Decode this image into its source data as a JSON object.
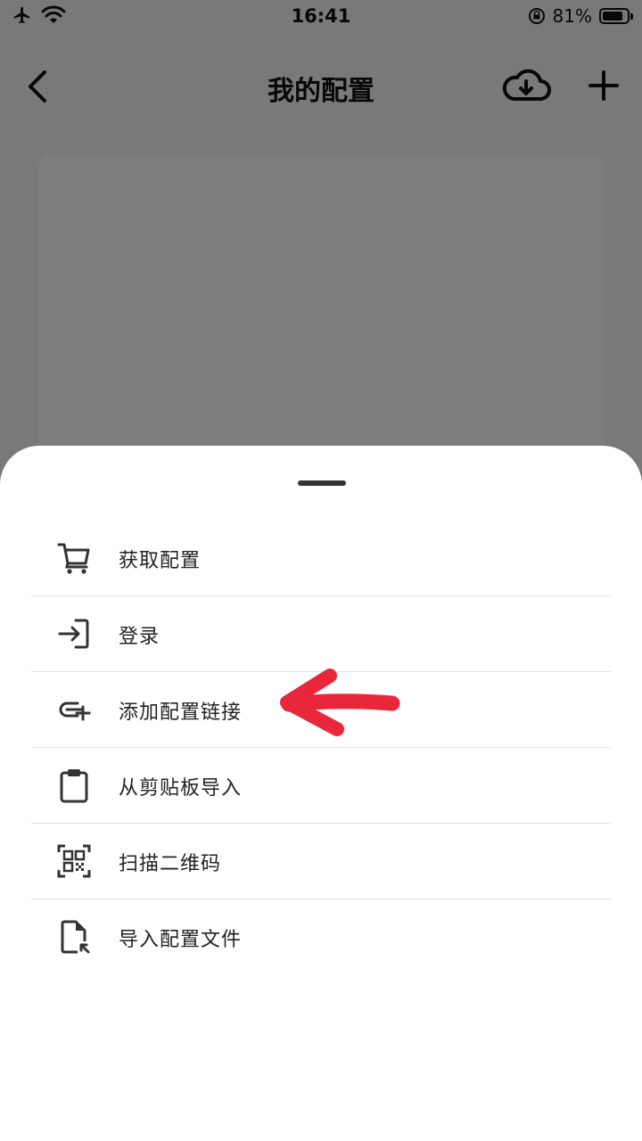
{
  "status_bar": {
    "time": "16:41",
    "battery_percent": "81%",
    "icons": [
      "airplane-icon",
      "wifi-icon",
      "rotation-lock-icon",
      "battery-icon"
    ]
  },
  "nav": {
    "title": "我的配置",
    "icons": [
      "back-chevron-icon",
      "cloud-download-icon",
      "plus-icon"
    ]
  },
  "sheet": {
    "items": [
      {
        "label": "获取配置",
        "icon": "cart-icon"
      },
      {
        "label": "登录",
        "icon": "login-icon"
      },
      {
        "label": "添加配置链接",
        "icon": "add-link-icon"
      },
      {
        "label": "从剪贴板导入",
        "icon": "clipboard-icon"
      },
      {
        "label": "扫描二维码",
        "icon": "qr-scan-icon"
      },
      {
        "label": "导入配置文件",
        "icon": "file-import-icon"
      }
    ]
  },
  "colors": {
    "annotation_arrow": "#e8283a",
    "overlay": "#000000",
    "sheet_background": "#ffffff",
    "icon": "#333333"
  }
}
